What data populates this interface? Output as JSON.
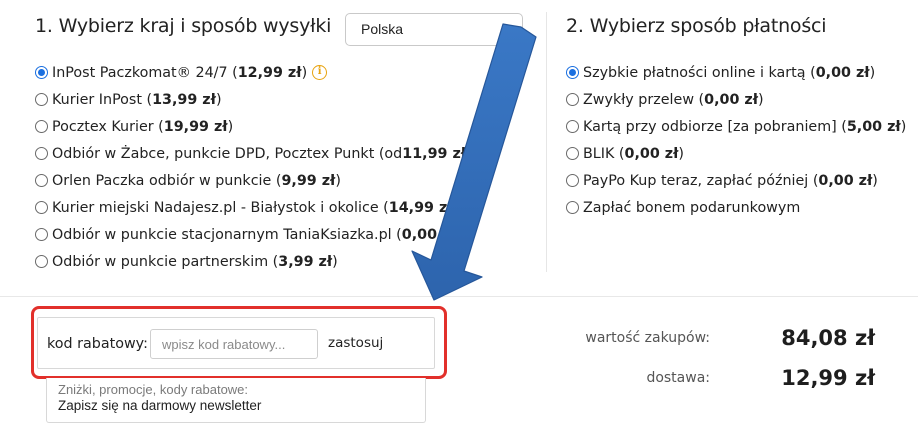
{
  "shipping": {
    "heading": "1. Wybierz kraj i sposób wysyłki",
    "country_select": {
      "value": "Polska",
      "icon": "chevron-down-icon"
    },
    "options": [
      {
        "label": "InPost Paczkomat® 24/7 (",
        "price": "12,99 zł",
        "suffix": ")",
        "selected": true,
        "info_icon": true
      },
      {
        "label": "Kurier InPost (",
        "price": "13,99 zł",
        "suffix": ")",
        "selected": false
      },
      {
        "label": "Pocztex Kurier (",
        "price": "19,99 zł",
        "suffix": ")",
        "selected": false
      },
      {
        "label": "Odbiór w Żabce, punkcie DPD, Pocztex Punkt (od ",
        "price": "11,99 zł",
        "suffix": ")",
        "selected": false,
        "info_icon": true
      },
      {
        "label": "Orlen Paczka odbiór w punkcie (",
        "price": "9,99 zł",
        "suffix": ")",
        "selected": false
      },
      {
        "label": "Kurier miejski Nadajesz.pl - Białystok i okolice (",
        "price": "14,99 zł",
        "suffix": ")",
        "selected": false
      },
      {
        "label": "Odbiór w punkcie stacjonarnym TaniaKsiazka.pl (",
        "price": "0,00 zł",
        "suffix": ")",
        "selected": false
      },
      {
        "label": "Odbiór w punkcie partnerskim (",
        "price": "3,99 zł",
        "suffix": ")",
        "selected": false
      }
    ]
  },
  "payment": {
    "heading": "2. Wybierz sposób płatności",
    "options": [
      {
        "label": "Szybkie płatności online i kartą (",
        "price": "0,00 zł",
        "suffix": ")",
        "selected": true
      },
      {
        "label": "Zwykły przelew (",
        "price": "0,00 zł",
        "suffix": ")",
        "selected": false
      },
      {
        "label": "Kartą przy odbiorze [za pobraniem] (",
        "price": "5,00 zł",
        "suffix": ")",
        "selected": false
      },
      {
        "label": "BLIK (",
        "price": "0,00 zł",
        "suffix": ")",
        "selected": false
      },
      {
        "label": "PayPo Kup teraz, zapłać później (",
        "price": "0,00 zł",
        "suffix": ")",
        "selected": false
      },
      {
        "label": "Zapłać bonem podarunkowym",
        "price": "",
        "suffix": "",
        "selected": false
      }
    ]
  },
  "coupon": {
    "label": "kod rabatowy:",
    "input_value": "",
    "placeholder": "wpisz kod rabatowy...",
    "apply_label": "zastosuj"
  },
  "newsletter": {
    "line1": "Zniżki, promocje, kody rabatowe:",
    "line2": "Zapisz się na darmowy newsletter"
  },
  "summary": {
    "purchase_label": "wartość zakupów:",
    "purchase_value": "84,08 zł",
    "delivery_label": "dostawa:",
    "delivery_value": "12,99 zł"
  },
  "colors": {
    "accent_blue": "#1a6fe0",
    "highlight_red": "#e2302b",
    "info_orange": "#e8a310",
    "arrow_blue": "#3470c2"
  }
}
